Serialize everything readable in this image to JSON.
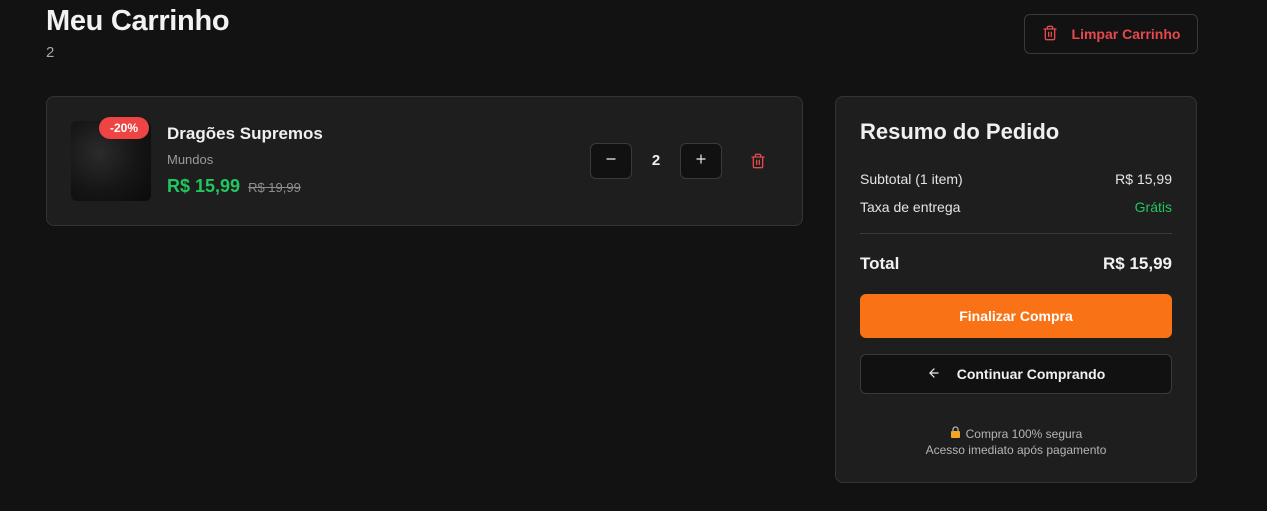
{
  "header": {
    "title": "Meu Carrinho",
    "count": "2",
    "clear_label": "Limpar Carrinho"
  },
  "cart": {
    "items": [
      {
        "name": "Dragões Supremos",
        "category": "Mundos",
        "badge": "-20%",
        "price": "R$ 15,99",
        "old_price": "R$ 19,99",
        "quantity": "2"
      }
    ]
  },
  "summary": {
    "title": "Resumo do Pedido",
    "subtotal_label": "Subtotal (1 item)",
    "subtotal_value": "R$ 15,99",
    "delivery_label": "Taxa de entrega",
    "delivery_value": "Grátis",
    "total_label": "Total",
    "total_value": "R$ 15,99",
    "checkout_label": "Finalizar Compra",
    "continue_label": "Continuar Comprando",
    "secure_text": "Compra 100% segura",
    "access_text": "Acesso imediato após pagamento"
  },
  "colors": {
    "background": "#121212",
    "accent": "#f97316",
    "success": "#22c55e",
    "danger": "#e5484d",
    "badge": "#ef4444"
  },
  "icons": {
    "clear": "trash-icon",
    "minus": "minus-icon",
    "plus": "plus-icon",
    "remove": "trash-icon",
    "back": "arrow-left-icon",
    "secure": "lock-icon"
  }
}
